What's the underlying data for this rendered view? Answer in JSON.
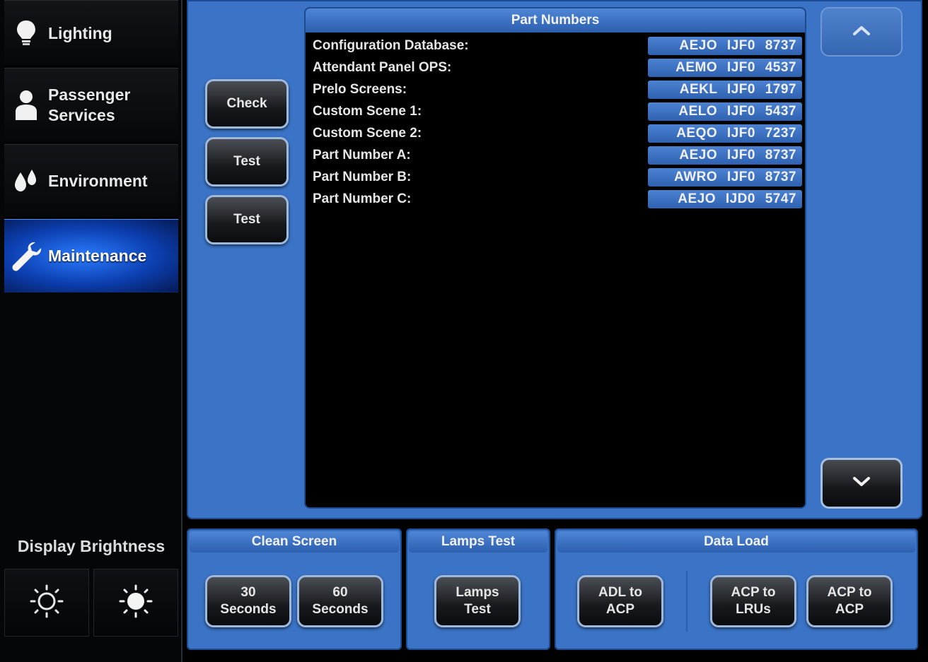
{
  "sidebar": {
    "items": [
      {
        "label": "Lighting",
        "icon": "lightbulb-icon"
      },
      {
        "label": "Passenger\nServices",
        "icon": "person-icon"
      },
      {
        "label": "Environment",
        "icon": "droplets-icon"
      },
      {
        "label": "Maintenance",
        "icon": "wrench-icon",
        "active": true
      }
    ],
    "brightness_label": "Display Brightness",
    "brightness_icons": [
      "sun-dim-icon",
      "sun-bright-icon"
    ]
  },
  "actions": {
    "check_label": "Check",
    "test1_label": "Test",
    "test2_label": "Test"
  },
  "part_numbers": {
    "title": "Part Numbers",
    "rows": [
      {
        "label": "Configuration Database:",
        "value": "AEJO IJF0 8737"
      },
      {
        "label": "Attendant Panel OPS:",
        "value": "AEMO IJF0 4537"
      },
      {
        "label": "Prelo  Screens:",
        "value": "AEKL IJF0 1797"
      },
      {
        "label": "Custom Scene 1:",
        "value": "AELO IJF0 5437"
      },
      {
        "label": "Custom Scene 2:",
        "value": "AEQO IJF0 7237"
      },
      {
        "label": "Part Number A:",
        "value": "AEJO IJF0 8737"
      },
      {
        "label": "Part Number B:",
        "value": "AWRO IJF0 8737"
      },
      {
        "label": "Part Number C:",
        "value": "AEJO IJD0 5747"
      }
    ]
  },
  "clean_screen": {
    "title": "Clean Screen",
    "btn30": "30\nSeconds",
    "btn60": "60\nSeconds"
  },
  "lamps_test": {
    "title": "Lamps Test",
    "btn": "Lamps\nTest"
  },
  "data_load": {
    "title": "Data Load",
    "adl_acp": "ADL to\nACP",
    "acp_lrus": "ACP to\nLRUs",
    "acp_acp": "ACP to\nACP"
  },
  "colors": {
    "panel_blue": "#3b74c6",
    "active_blue": "#1d5fe0",
    "background": "#000000"
  }
}
